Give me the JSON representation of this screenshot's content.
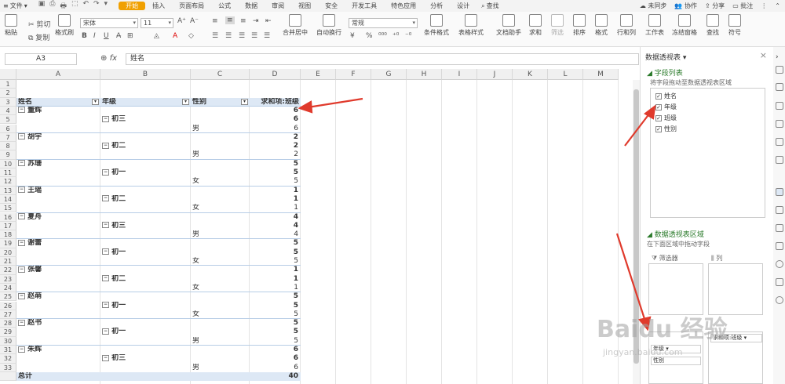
{
  "menu": {
    "file": "文件",
    "tabs": [
      "开始",
      "插入",
      "页面布局",
      "公式",
      "数据",
      "审阅",
      "视图",
      "安全",
      "开发工具",
      "特色应用",
      "分析",
      "设计"
    ],
    "active_tab": "开始",
    "search": "查找",
    "sync": "未同步",
    "collab": "协作",
    "share": "分享",
    "comment": "批注"
  },
  "ribbon": {
    "paste": "粘贴",
    "cut": "剪切",
    "copy": "复制",
    "format_painter": "格式刷",
    "font_name": "宋体",
    "font_size": "11",
    "number_format": "常规",
    "merge": "合并居中",
    "wrap": "自动换行",
    "cond_format": "条件格式",
    "table_style": "表格样式",
    "doc_helper": "文档助手",
    "sum": "求和",
    "filter": "筛选",
    "sort": "排序",
    "format": "格式",
    "row_col": "行和列",
    "worksheet": "工作表",
    "freeze": "冻结窗格",
    "find": "查找",
    "symbol": "符号"
  },
  "formula_bar": {
    "cell_ref": "A3",
    "fx": "fx",
    "content": "姓名"
  },
  "columns": [
    "A",
    "B",
    "C",
    "D",
    "E",
    "F",
    "G",
    "H",
    "I",
    "J",
    "K",
    "L",
    "M"
  ],
  "rows": [
    "1",
    "2",
    "3",
    "4",
    "5",
    "6",
    "7",
    "8",
    "9",
    "10",
    "11",
    "12",
    "13",
    "14",
    "15",
    "16",
    "17",
    "18",
    "19",
    "20",
    "21",
    "22",
    "23",
    "24",
    "25",
    "26",
    "27",
    "28",
    "29",
    "30",
    "31",
    "32",
    "33"
  ],
  "pivot": {
    "headers": [
      "姓名",
      "年级",
      "性别",
      "求和项:班级"
    ],
    "cells": [
      {
        "r": 4,
        "name": "董辉",
        "val": "6",
        "bold": true
      },
      {
        "r": 5,
        "grade": "初三",
        "val": "6",
        "bold": true
      },
      {
        "r": 6,
        "sex": "男",
        "val": "6"
      },
      {
        "r": 7,
        "name": "胡宇",
        "val": "2",
        "bold": true
      },
      {
        "r": 8,
        "grade": "初二",
        "val": "2",
        "bold": true
      },
      {
        "r": 9,
        "sex": "男",
        "val": "2"
      },
      {
        "r": 10,
        "name": "苏珊",
        "val": "5",
        "bold": true
      },
      {
        "r": 11,
        "grade": "初一",
        "val": "5",
        "bold": true
      },
      {
        "r": 12,
        "sex": "女",
        "val": "5"
      },
      {
        "r": 13,
        "name": "王瑶",
        "val": "1",
        "bold": true
      },
      {
        "r": 14,
        "grade": "初二",
        "val": "1",
        "bold": true
      },
      {
        "r": 15,
        "sex": "女",
        "val": "1"
      },
      {
        "r": 16,
        "name": "夏舟",
        "val": "4",
        "bold": true
      },
      {
        "r": 17,
        "grade": "初三",
        "val": "4",
        "bold": true
      },
      {
        "r": 18,
        "sex": "男",
        "val": "4"
      },
      {
        "r": 19,
        "name": "谢蕾",
        "val": "5",
        "bold": true
      },
      {
        "r": 20,
        "grade": "初一",
        "val": "5",
        "bold": true
      },
      {
        "r": 21,
        "sex": "女",
        "val": "5"
      },
      {
        "r": 22,
        "name": "张馨",
        "val": "1",
        "bold": true
      },
      {
        "r": 23,
        "grade": "初二",
        "val": "1",
        "bold": true
      },
      {
        "r": 24,
        "sex": "女",
        "val": "1"
      },
      {
        "r": 25,
        "name": "赵萌",
        "val": "5",
        "bold": true
      },
      {
        "r": 26,
        "grade": "初一",
        "val": "5",
        "bold": true
      },
      {
        "r": 27,
        "sex": "女",
        "val": "5"
      },
      {
        "r": 28,
        "name": "赵书",
        "val": "5",
        "bold": true
      },
      {
        "r": 29,
        "grade": "初一",
        "val": "5",
        "bold": true
      },
      {
        "r": 30,
        "sex": "男",
        "val": "5"
      },
      {
        "r": 31,
        "name": "朱辉",
        "val": "6",
        "bold": true
      },
      {
        "r": 32,
        "grade": "初三",
        "val": "6",
        "bold": true
      },
      {
        "r": 33,
        "sex": "男",
        "val": "6"
      }
    ],
    "total_label": "总计",
    "total_value": "40"
  },
  "pane": {
    "title": "数据透视表",
    "field_list": "字段列表",
    "field_hint": "将字段拖动至数据透视表区域",
    "fields": [
      "姓名",
      "年级",
      "班级",
      "性别"
    ],
    "area_title": "数据透视表区域",
    "area_hint": "在下面区域中拖动字段",
    "filter": "筛选器",
    "columns": "列",
    "row_fields": [
      "年级",
      "性别"
    ],
    "value_field": "求和项:班级"
  },
  "watermark": {
    "brand": "Baidu 经验",
    "url": "jingyan.baidu.com"
  }
}
